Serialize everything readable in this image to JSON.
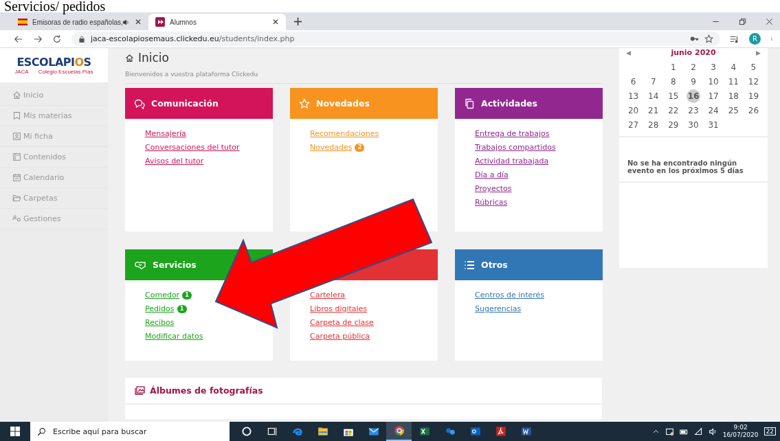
{
  "document_heading": "Servicios/ pedidos",
  "browser": {
    "tabs": [
      {
        "title": "Emisoras de radio españolas,",
        "selected": false,
        "audio": true,
        "close": "✕"
      },
      {
        "title": "Alumnos",
        "selected": true,
        "audio": false,
        "close": "✕"
      }
    ],
    "new_tab": "+",
    "url_host": "jaca-escolapiosemaus.clickedu.eu",
    "url_path": "/students/index.php",
    "profile_initial": "R"
  },
  "logo": {
    "name_start": "ESCOLAPI",
    "name_mark": "O",
    "name_end": "S",
    "city": "JACA",
    "subtitle": "Colegio Escuelas Pías"
  },
  "sidebar": {
    "items": [
      {
        "label": "Inicio"
      },
      {
        "label": "Mis materias"
      },
      {
        "label": "Mi ficha"
      },
      {
        "label": "Contenidos"
      },
      {
        "label": "Calendario"
      },
      {
        "label": "Carpetas"
      },
      {
        "label": "Gestiones"
      }
    ]
  },
  "header": {
    "title": "Inicio",
    "subtitle": "Bienvenidos a vuestra plataforma Clickedu"
  },
  "cards": [
    {
      "title": "Comunicación",
      "color": "#d3145a",
      "links": [
        {
          "label": "Mensajería"
        },
        {
          "label": "Conversaciones del tutor"
        },
        {
          "label": "Avisos del tutor"
        }
      ]
    },
    {
      "title": "Novedades",
      "color": "#f7931e",
      "links": [
        {
          "label": "Recomendaciones"
        },
        {
          "label": "Novedades",
          "badge": "2"
        }
      ]
    },
    {
      "title": "Actividades",
      "color": "#92278f",
      "links": [
        {
          "label": "Entrega de trabajos"
        },
        {
          "label": "Trabajos compartidos"
        },
        {
          "label": "Actividad trabajada"
        },
        {
          "label": "Día a día"
        },
        {
          "label": "Proyectos"
        },
        {
          "label": "Rúbricas"
        }
      ]
    },
    {
      "title": "Servicios",
      "color": "#1ca51c",
      "links": [
        {
          "label": "Comedor",
          "badge": "1"
        },
        {
          "label": "Pedidos",
          "badge": "1"
        },
        {
          "label": "Recibos"
        },
        {
          "label": "Modificar datos"
        }
      ]
    },
    {
      "color": "#e33236",
      "links": [
        {
          "label": "Cartelera"
        },
        {
          "label": "Libros digitales"
        },
        {
          "label": "Carpeta de clase"
        },
        {
          "label": "Carpeta pública"
        }
      ]
    },
    {
      "title": "Otros",
      "color": "#3277b5",
      "links": [
        {
          "label": "Centros de interés"
        },
        {
          "label": "Sugerencias"
        }
      ]
    }
  ],
  "albums": {
    "title": "Álbumes de fotografías"
  },
  "calendar": {
    "month": "junio 2020",
    "prev": "◀",
    "next": "▶",
    "weeks": [
      [
        {
          "label": "1",
          "selected": false
        },
        {
          "label": "2",
          "selected": false
        },
        {
          "label": "3",
          "selected": false
        },
        {
          "label": "4",
          "selected": false
        },
        {
          "label": "5",
          "selected": false
        }
      ],
      [
        {
          "label": "6",
          "selected": false
        },
        {
          "label": "7",
          "selected": false
        },
        {
          "label": "8",
          "selected": false
        },
        {
          "label": "9",
          "selected": false
        },
        {
          "label": "10",
          "selected": false
        },
        {
          "label": "11",
          "selected": false
        },
        {
          "label": "12",
          "selected": false
        }
      ],
      [
        {
          "label": "13",
          "selected": false
        },
        {
          "label": "14",
          "selected": false
        },
        {
          "label": "15",
          "selected": false
        },
        {
          "label": "16",
          "selected": true
        },
        {
          "label": "17",
          "selected": false
        },
        {
          "label": "18",
          "selected": false
        },
        {
          "label": "19",
          "selected": false
        }
      ],
      [
        {
          "label": "20",
          "selected": false
        },
        {
          "label": "21",
          "selected": false
        },
        {
          "label": "22",
          "selected": false
        },
        {
          "label": "23",
          "selected": false
        },
        {
          "label": "24",
          "selected": false
        },
        {
          "label": "25",
          "selected": false
        },
        {
          "label": "26",
          "selected": false
        }
      ],
      [
        {
          "label": "27",
          "selected": false
        },
        {
          "label": "28",
          "selected": false
        },
        {
          "label": "29",
          "selected": false
        },
        {
          "label": "30",
          "selected": false
        },
        {
          "label": "31",
          "selected": false
        }
      ]
    ],
    "events_message": "No se ha encontrado ningún evento en los próximos 5 días"
  },
  "taskbar": {
    "search_placeholder": "Escribe aquí para buscar",
    "apps": [
      {
        "kind": "cortana",
        "selected": false
      },
      {
        "kind": "taskview",
        "selected": false
      },
      {
        "kind": "edge",
        "selected": false
      },
      {
        "kind": "explorer",
        "selected": false
      },
      {
        "kind": "store",
        "selected": false
      },
      {
        "kind": "mail",
        "selected": false
      },
      {
        "kind": "chrome",
        "selected": true
      },
      {
        "kind": "excel",
        "selected": false
      },
      {
        "kind": "people",
        "selected": false
      },
      {
        "kind": "outlook",
        "selected": false
      },
      {
        "kind": "acrobat",
        "selected": false
      },
      {
        "kind": "word",
        "selected": false
      }
    ],
    "time": "9:02",
    "date": "16/07/2020",
    "notifications": "22"
  }
}
